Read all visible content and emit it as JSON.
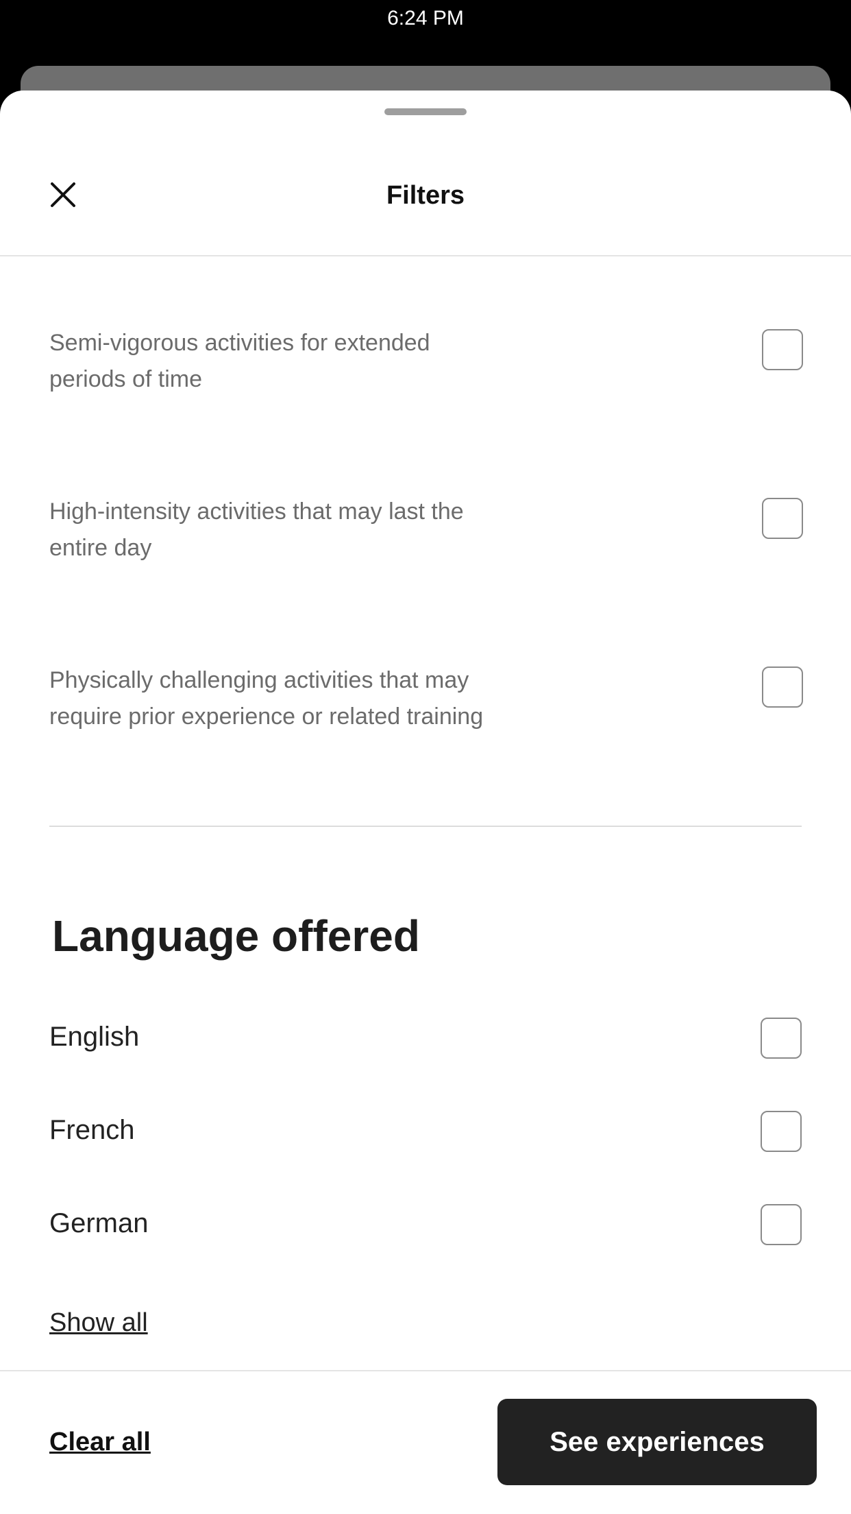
{
  "status_bar": {
    "time": "6:24 PM",
    "right_text": ""
  },
  "header": {
    "title": "Filters",
    "close_icon": "close-x-icon"
  },
  "activity_levels": [
    {
      "caption_line1": "Semi-vigorous activities for extended",
      "caption_line2": "periods of time",
      "checked": false
    },
    {
      "caption_line1": "High-intensity activities that may last the",
      "caption_line2": "entire day",
      "checked": false
    },
    {
      "caption_line1": "Physically challenging activities that may",
      "caption_line2": "require prior experience or related training",
      "checked": false
    }
  ],
  "language_section": {
    "title": "Language offered",
    "options": [
      {
        "label": "English",
        "checked": false
      },
      {
        "label": "French",
        "checked": false
      },
      {
        "label": "German",
        "checked": false
      }
    ],
    "show_all": "Show all"
  },
  "footer": {
    "clear_all": "Clear all",
    "cta": "See experiences"
  },
  "colors": {
    "cta_bg": "#222222",
    "sheet_bg": "#ffffff",
    "caption": "#6b6b6b"
  }
}
